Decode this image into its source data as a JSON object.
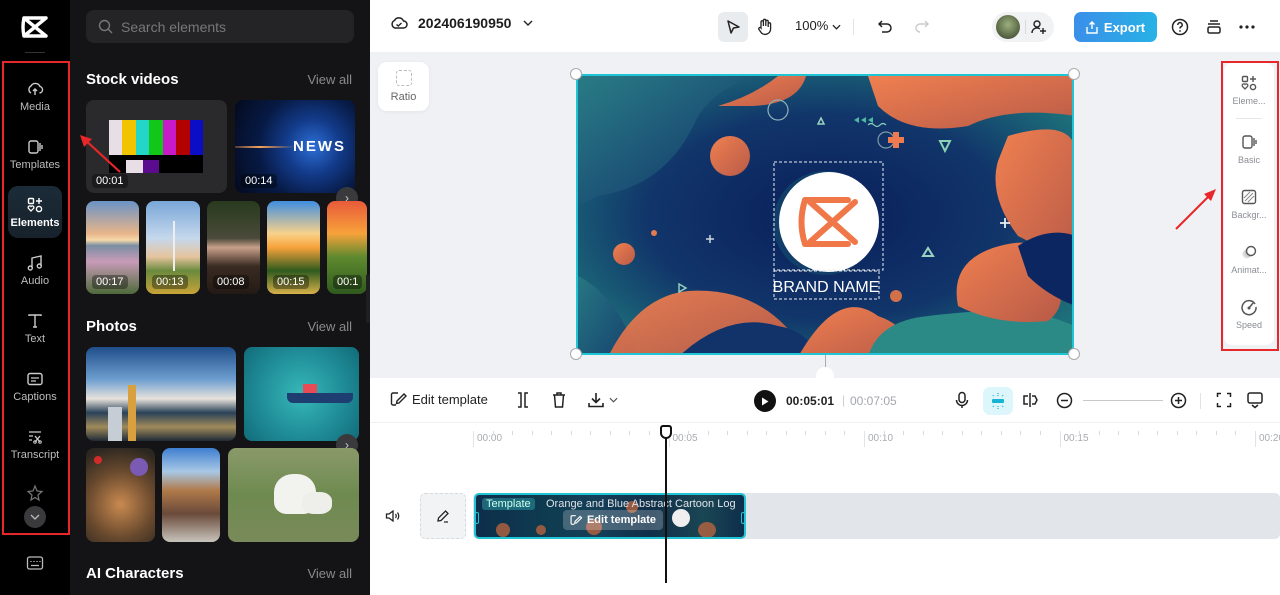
{
  "rail": {
    "items": [
      {
        "label": "Media",
        "icon": "cloud-upload-icon"
      },
      {
        "label": "Templates",
        "icon": "templates-icon"
      },
      {
        "label": "Elements",
        "icon": "elements-icon",
        "active": true
      },
      {
        "label": "Audio",
        "icon": "music-note-icon"
      },
      {
        "label": "Text",
        "icon": "text-icon"
      },
      {
        "label": "Captions",
        "icon": "captions-icon"
      },
      {
        "label": "Transcript",
        "icon": "transcript-icon"
      }
    ]
  },
  "panel": {
    "search_placeholder": "Search elements",
    "stock_videos": {
      "title": "Stock videos",
      "view_all": "View all",
      "featured": [
        {
          "duration": "00:01",
          "subject": "color bars test pattern"
        },
        {
          "duration": "00:14",
          "subject": "news globe"
        }
      ],
      "portrait": [
        {
          "duration": "00:17",
          "subject": "sunset lake flowers"
        },
        {
          "duration": "00:13",
          "subject": "wind turbine"
        },
        {
          "duration": "00:08",
          "subject": "person with headphones"
        },
        {
          "duration": "00:15",
          "subject": "sunflowers sunset"
        },
        {
          "duration": "00:1",
          "subject": "field sunset"
        }
      ]
    },
    "photos": {
      "title": "Photos",
      "view_all": "View all",
      "items": [
        "city skyline",
        "boat on sea",
        "tacos",
        "narrow street",
        "white puppy"
      ]
    },
    "ai_characters": {
      "title": "AI Characters",
      "view_all": "View all"
    }
  },
  "topbar": {
    "project_name": "202406190950",
    "zoom": "100%",
    "export_label": "Export"
  },
  "stage": {
    "ratio_label": "Ratio",
    "brand_name": "BRAND NAME",
    "colors": {
      "selection": "#20c5d5",
      "accent_orange": "#e8754a",
      "deep_blue": "#0c2a5e"
    }
  },
  "properties": {
    "items": [
      {
        "label": "Eleme...",
        "icon": "elements-icon"
      },
      {
        "label": "Basic",
        "icon": "basic-icon"
      },
      {
        "label": "Backgr...",
        "icon": "background-icon"
      },
      {
        "label": "Animat...",
        "icon": "animation-icon"
      },
      {
        "label": "Speed",
        "icon": "speed-icon"
      }
    ]
  },
  "timeline_toolbar": {
    "edit_template_label": "Edit template",
    "current_time": "00:05:01",
    "separator": "|",
    "total_time": "00:07:05"
  },
  "timeline": {
    "ruler": [
      "00:00",
      "00:05",
      "00:10",
      "00:15",
      "00:20"
    ],
    "clip": {
      "tag": "Template",
      "name": "Orange and Blue Abstract Cartoon Log",
      "edit_label": "Edit template"
    }
  },
  "annotations": {
    "highlight_color": "#e8272a"
  }
}
